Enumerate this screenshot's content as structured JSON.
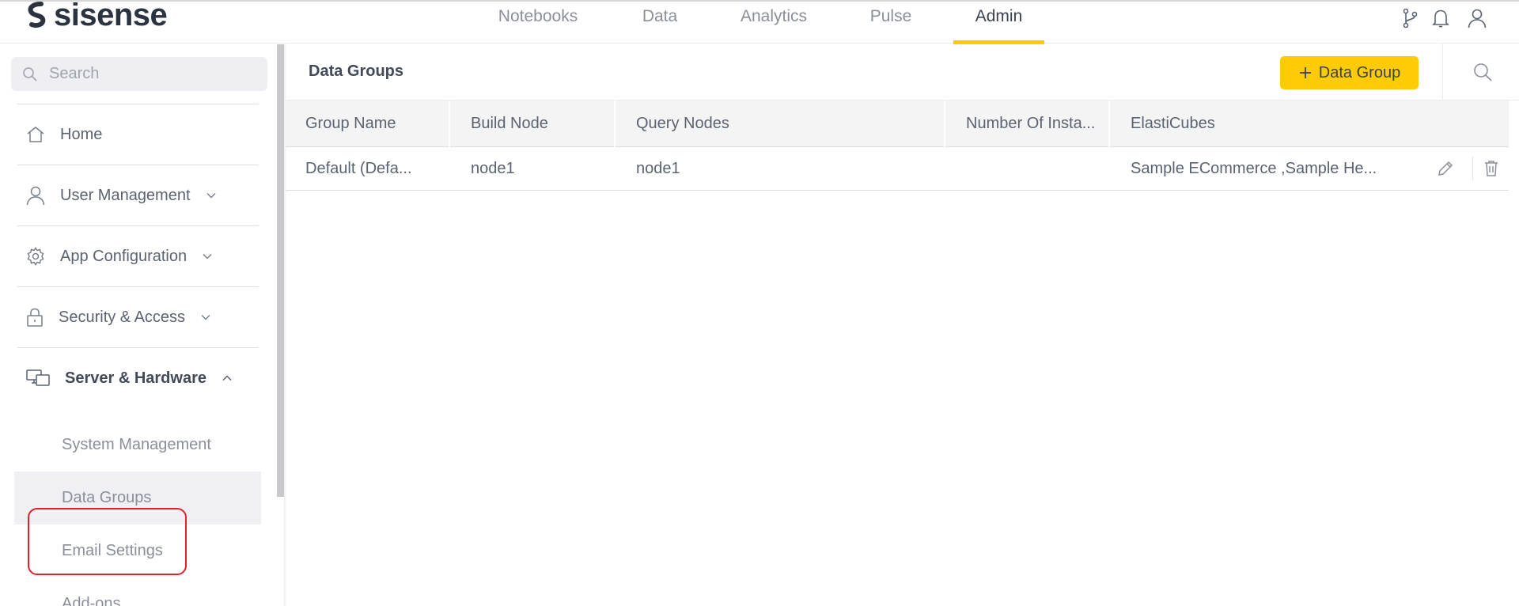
{
  "app": {
    "logo_text": "sisense"
  },
  "topnav": {
    "tabs": [
      {
        "label": "Notebooks"
      },
      {
        "label": "Data"
      },
      {
        "label": "Analytics"
      },
      {
        "label": "Pulse"
      },
      {
        "label": "Admin",
        "active": true
      }
    ],
    "icons": [
      "git-branch-icon",
      "bell-icon",
      "user-icon"
    ],
    "accent_color": "#ffcb05"
  },
  "sidebar": {
    "search": {
      "placeholder": "Search",
      "value": ""
    },
    "items": [
      {
        "label": "Home",
        "icon": "home-icon"
      },
      {
        "label": "User Management",
        "icon": "user-icon",
        "expandable": true
      },
      {
        "label": "App Configuration",
        "icon": "gear-icon",
        "expandable": true
      },
      {
        "label": "Security & Access",
        "icon": "lock-icon",
        "expandable": true
      },
      {
        "label": "Server & Hardware",
        "icon": "monitors-icon",
        "expanded": true
      }
    ],
    "sub_items": [
      {
        "label": "System Management"
      },
      {
        "label": "Data Groups",
        "selected": true
      },
      {
        "label": "Email Settings"
      },
      {
        "label": "Add-ons"
      }
    ],
    "highlight_color": "#e0202a"
  },
  "main": {
    "title": "Data Groups",
    "add_button_label": "Data Group",
    "table": {
      "columns": [
        "Group Name",
        "Build Node",
        "Query Nodes",
        "Number Of Insta...",
        "ElastiCubes"
      ],
      "rows": [
        {
          "group_name": "Default (Defa...",
          "build_node": "node1",
          "query_nodes": "node1",
          "instances": "",
          "elasticubes": "Sample ECommerce ,Sample He..."
        }
      ]
    }
  }
}
